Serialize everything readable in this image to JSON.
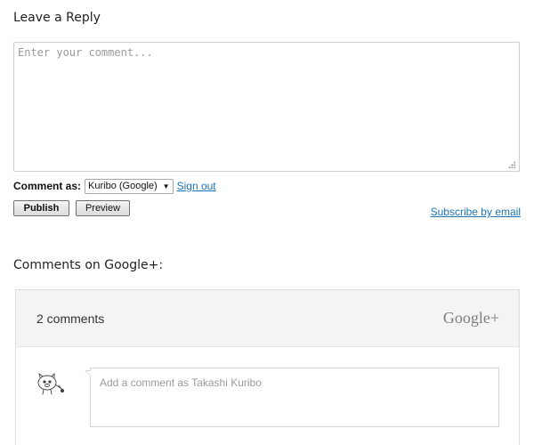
{
  "reply": {
    "heading": "Leave a Reply",
    "comment_placeholder": "Enter your comment...",
    "comment_value": ""
  },
  "comment_as": {
    "label": "Comment as:",
    "selected_identity": "Kuribo (Google)",
    "sign_out_label": "Sign out"
  },
  "actions": {
    "publish_label": "Publish",
    "preview_label": "Preview",
    "subscribe_label": "Subscribe by email"
  },
  "gplus": {
    "heading": "Comments on Google+:",
    "comment_count": "2 comments",
    "brand": "Google+",
    "add_comment_placeholder": "Add a comment as Takashi Kuribo"
  },
  "colors": {
    "link": "#1a74b8",
    "panel_header_bg": "#f3f4f3"
  }
}
